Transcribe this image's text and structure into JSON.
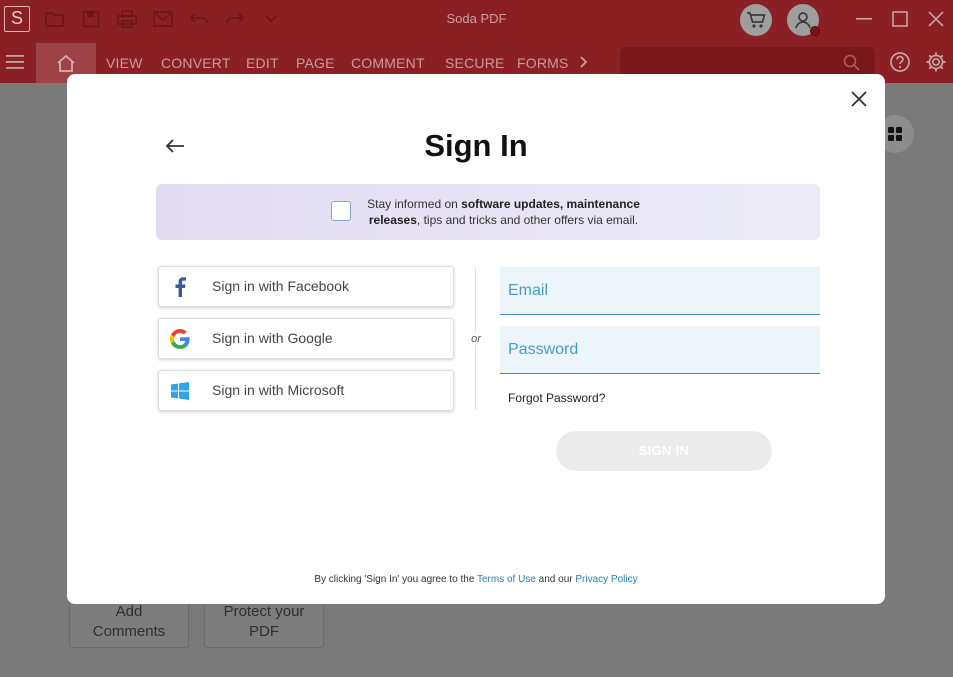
{
  "app": {
    "title": "Soda PDF",
    "logo_letter": "S"
  },
  "ribbon": {
    "tabs": [
      "VIEW",
      "CONVERT",
      "EDIT",
      "PAGE",
      "COMMENT",
      "SECURE",
      "FORMS"
    ]
  },
  "background": {
    "buttons": [
      "Add Comments",
      "Protect your PDF"
    ]
  },
  "modal": {
    "title": "Sign In",
    "newsletter": {
      "prefix": "Stay informed on ",
      "bold": "software updates, maintenance releases",
      "suffix": ", tips and tricks and other offers via email.",
      "checked": false
    },
    "social": {
      "facebook": "Sign in with Facebook",
      "google": "Sign in with Google",
      "microsoft": "Sign in with Microsoft"
    },
    "or_label": "or",
    "email_placeholder": "Email",
    "password_placeholder": "Password",
    "forgot_password": "Forgot Password?",
    "signin_button": "SIGN IN",
    "legal": {
      "prefix": "By clicking 'Sign In' you agree to the ",
      "terms": "Terms of Use",
      "middle": " and our ",
      "privacy": "Privacy Policy"
    }
  },
  "colors": {
    "brand_red": "#8a1f24",
    "link_blue": "#2a7fb0",
    "facebook_blue": "#3b5998",
    "microsoft_blue": "#2fa4e7"
  }
}
